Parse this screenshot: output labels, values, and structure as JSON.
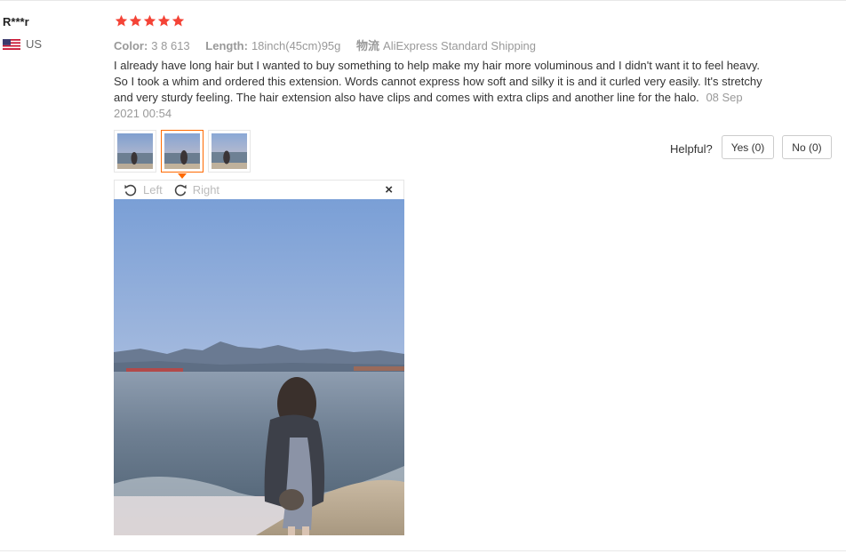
{
  "review": {
    "user_name": "R***r",
    "country": "US",
    "rating": 5,
    "sku": [
      {
        "key": "Color:",
        "value": "3 8 613"
      },
      {
        "key": "Length:",
        "value": "18inch(45cm)95g"
      },
      {
        "key": "物流",
        "value": "AliExpress Standard Shipping"
      }
    ],
    "text": "I already have long hair but I wanted to buy something to help make my hair more voluminous and I didn't want it to feel heavy. So I took a whim and ordered this extension. Words cannot express how soft and silky it is and it curled very easily. It's stretchy and very sturdy feeling. The hair extension also have clips and comes with extra clips and another line for the halo.",
    "date": "08 Sep 2021 00:54",
    "photo_count": 3,
    "selected_photo": 2
  },
  "helpful": {
    "label": "Helpful?",
    "yes": "Yes (0)",
    "no": "No (0)"
  },
  "viewer": {
    "rotate_left": "Left",
    "rotate_right": "Right",
    "close": "×"
  },
  "colors": {
    "star": "#f44336",
    "accent": "#ff6a00",
    "muted": "#999999"
  }
}
